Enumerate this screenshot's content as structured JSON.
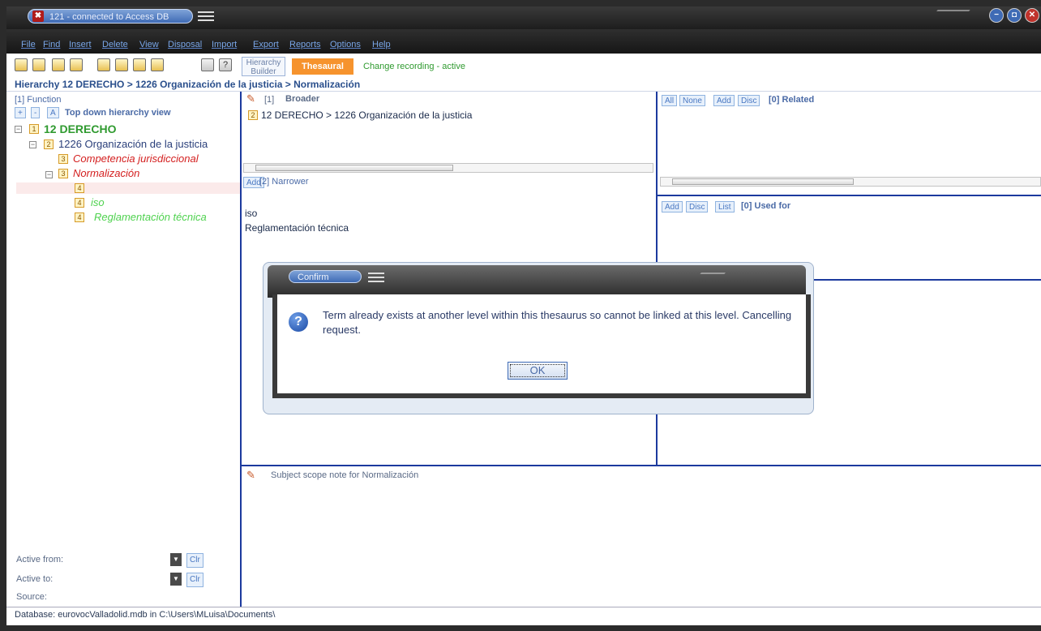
{
  "window": {
    "title": "121 - connected to Access DB"
  },
  "menu": [
    "File",
    "Find",
    "Insert",
    "Delete",
    "View",
    "Disposal",
    "Import",
    "Export",
    "Reports",
    "Options",
    "Help"
  ],
  "toolbar": {
    "hierarchy_builder": "Hierarchy Builder",
    "thesaural": "Thesaural",
    "change_recording": "Change recording - active"
  },
  "breadcrumb": "Hierarchy 12 DERECHO > 1226 Organización de la justicia > Normalización",
  "left": {
    "function_label": "[1] Function",
    "btn_plus": "+",
    "btn_minus": "-",
    "btn_a": "A",
    "view_label": "Top down hierarchy view",
    "tree": [
      {
        "level": "1",
        "label": "12 DERECHO"
      },
      {
        "level": "2",
        "label": "1226 Organización de la justicia"
      },
      {
        "level": "3",
        "label": "Competencia jurisdiccional"
      },
      {
        "level": "3",
        "label": "Normalización"
      },
      {
        "level": "4",
        "label": ""
      },
      {
        "level": "4",
        "label": "iso"
      },
      {
        "level": "4",
        "label": "Reglamentación técnica"
      }
    ],
    "active_from": "Active from:",
    "active_to": "Active to:",
    "source": "Source:",
    "clr": "Clr"
  },
  "broader": {
    "count": "[1]",
    "title": "Broader",
    "item_level": "2",
    "item": "12 DERECHO > 1226 Organización de la justicia"
  },
  "narrower": {
    "add": "Add",
    "title": "[2] Narrower",
    "items": [
      "iso",
      "Reglamentación técnica"
    ]
  },
  "related": {
    "all": "All",
    "none": "None",
    "add": "Add",
    "disc": "Disc",
    "title": "[0] Related"
  },
  "usedfor": {
    "add": "Add",
    "disc": "Disc",
    "list": "List",
    "title": "[0] Used for"
  },
  "scope_note": "Subject scope note for Normalización",
  "status": "Database: eurovocValladolid.mdb in C:\\Users\\MLuisa\\Documents\\",
  "dialog": {
    "title": "Confirm",
    "message": "Term already exists at another level within this thesaurus so cannot be linked at this level.  Cancelling request.",
    "ok": "OK"
  },
  "colors": {
    "accent": "#1c3a9e",
    "thesaural": "#f6932d",
    "green": "#2f9a2f",
    "red": "#d42020"
  }
}
